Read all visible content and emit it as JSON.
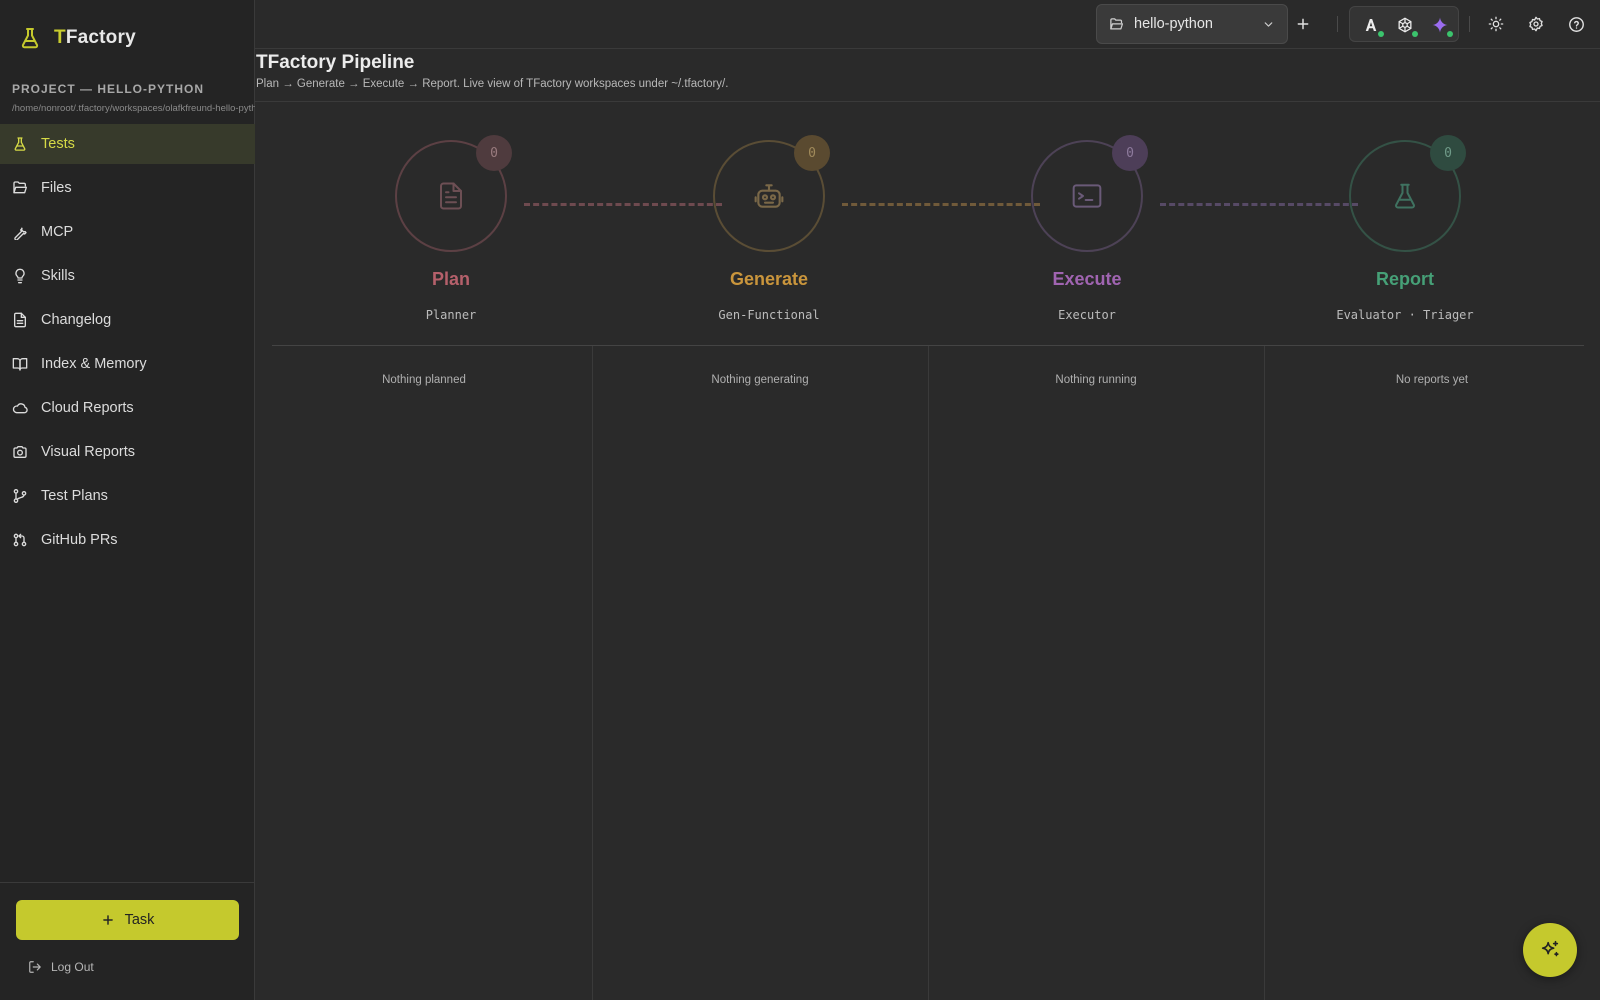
{
  "app": {
    "brand_first": "T",
    "brand_rest": "Factory"
  },
  "project": {
    "label": "PROJECT — HELLO-PYTHON",
    "path": "/home/nonroot/.tfactory/workspaces/olafkfreund-hello-python"
  },
  "sidebar": {
    "items": [
      {
        "label": "Tests",
        "icon": "flask-icon",
        "active": true
      },
      {
        "label": "Files",
        "icon": "folder-open-icon"
      },
      {
        "label": "MCP",
        "icon": "wrench-icon"
      },
      {
        "label": "Skills",
        "icon": "lightbulb-icon"
      },
      {
        "label": "Changelog",
        "icon": "file-text-icon"
      },
      {
        "label": "Index & Memory",
        "icon": "book-open-icon"
      },
      {
        "label": "Cloud Reports",
        "icon": "cloud-icon"
      },
      {
        "label": "Visual Reports",
        "icon": "camera-icon"
      },
      {
        "label": "Test Plans",
        "icon": "git-branch-icon"
      },
      {
        "label": "GitHub PRs",
        "icon": "git-pull-request-icon"
      }
    ],
    "task_button": "Task",
    "logout": "Log Out"
  },
  "topbar": {
    "project_select": "hello-python",
    "models": [
      "anthropic-icon",
      "openai-icon",
      "gemini-icon"
    ]
  },
  "page": {
    "title": "TFactory Pipeline",
    "subtitle": "Plan → Generate → Execute → Report. Live view of TFactory workspaces under ~/.tfactory/."
  },
  "pipeline": {
    "stages": [
      {
        "name": "Plan",
        "agent": "Planner",
        "count": "0",
        "color": "#b5606b",
        "icon": "document-icon",
        "empty": "Nothing planned"
      },
      {
        "name": "Generate",
        "agent": "Gen-Functional",
        "count": "0",
        "color": "#c9953c",
        "icon": "robot-icon",
        "empty": "Nothing generating"
      },
      {
        "name": "Execute",
        "agent": "Executor",
        "count": "0",
        "color": "#a064b1",
        "icon": "terminal-icon",
        "empty": "Nothing running"
      },
      {
        "name": "Report",
        "agent": "Evaluator · Triager",
        "count": "0",
        "color": "#46a077",
        "icon": "flask-icon",
        "empty": "No reports yet"
      }
    ]
  },
  "colors": {
    "accent": "#c5c92d",
    "background": "#2a2a2a",
    "sidebar": "#242424"
  }
}
